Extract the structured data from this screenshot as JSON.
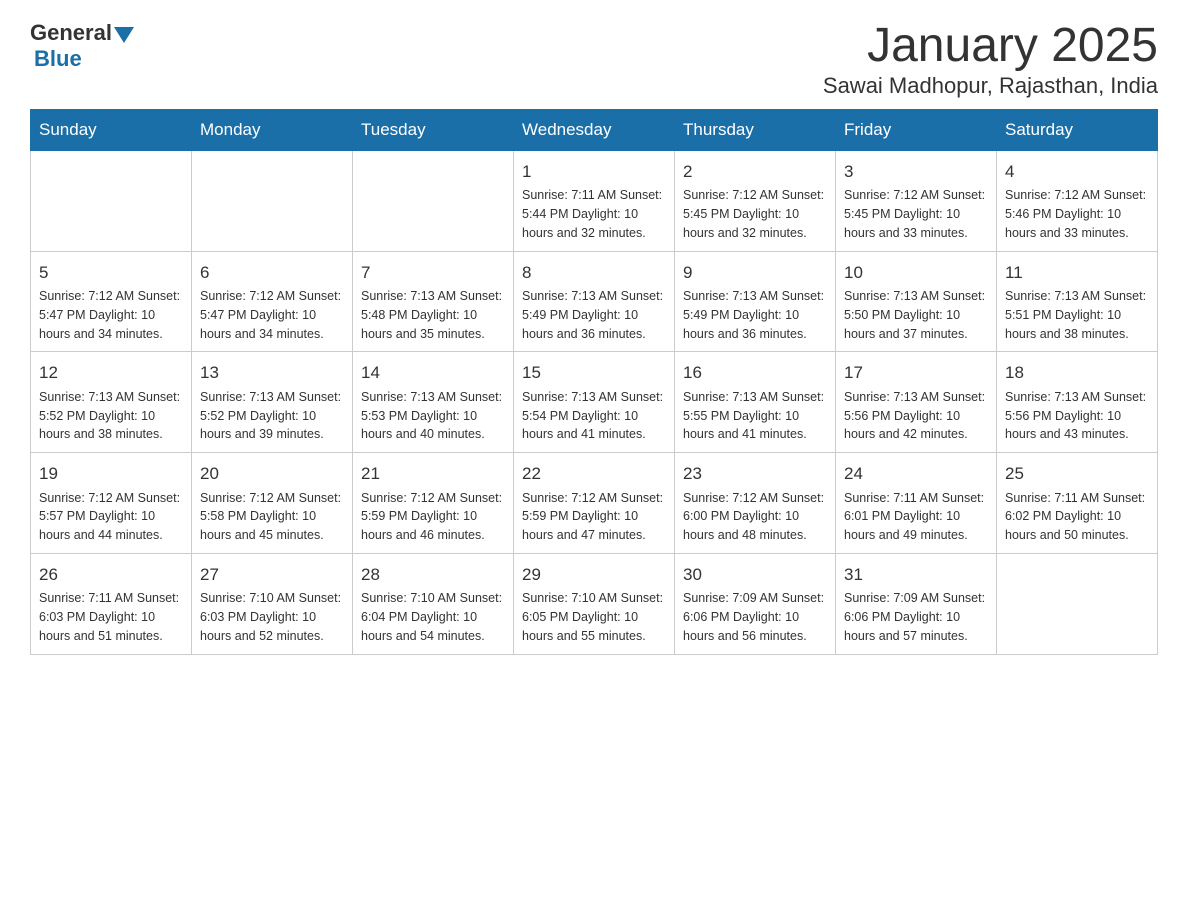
{
  "header": {
    "logo_general": "General",
    "logo_blue": "Blue",
    "title": "January 2025",
    "subtitle": "Sawai Madhopur, Rajasthan, India"
  },
  "days_of_week": [
    "Sunday",
    "Monday",
    "Tuesday",
    "Wednesday",
    "Thursday",
    "Friday",
    "Saturday"
  ],
  "weeks": [
    [
      {
        "day": "",
        "info": ""
      },
      {
        "day": "",
        "info": ""
      },
      {
        "day": "",
        "info": ""
      },
      {
        "day": "1",
        "info": "Sunrise: 7:11 AM\nSunset: 5:44 PM\nDaylight: 10 hours\nand 32 minutes."
      },
      {
        "day": "2",
        "info": "Sunrise: 7:12 AM\nSunset: 5:45 PM\nDaylight: 10 hours\nand 32 minutes."
      },
      {
        "day": "3",
        "info": "Sunrise: 7:12 AM\nSunset: 5:45 PM\nDaylight: 10 hours\nand 33 minutes."
      },
      {
        "day": "4",
        "info": "Sunrise: 7:12 AM\nSunset: 5:46 PM\nDaylight: 10 hours\nand 33 minutes."
      }
    ],
    [
      {
        "day": "5",
        "info": "Sunrise: 7:12 AM\nSunset: 5:47 PM\nDaylight: 10 hours\nand 34 minutes."
      },
      {
        "day": "6",
        "info": "Sunrise: 7:12 AM\nSunset: 5:47 PM\nDaylight: 10 hours\nand 34 minutes."
      },
      {
        "day": "7",
        "info": "Sunrise: 7:13 AM\nSunset: 5:48 PM\nDaylight: 10 hours\nand 35 minutes."
      },
      {
        "day": "8",
        "info": "Sunrise: 7:13 AM\nSunset: 5:49 PM\nDaylight: 10 hours\nand 36 minutes."
      },
      {
        "day": "9",
        "info": "Sunrise: 7:13 AM\nSunset: 5:49 PM\nDaylight: 10 hours\nand 36 minutes."
      },
      {
        "day": "10",
        "info": "Sunrise: 7:13 AM\nSunset: 5:50 PM\nDaylight: 10 hours\nand 37 minutes."
      },
      {
        "day": "11",
        "info": "Sunrise: 7:13 AM\nSunset: 5:51 PM\nDaylight: 10 hours\nand 38 minutes."
      }
    ],
    [
      {
        "day": "12",
        "info": "Sunrise: 7:13 AM\nSunset: 5:52 PM\nDaylight: 10 hours\nand 38 minutes."
      },
      {
        "day": "13",
        "info": "Sunrise: 7:13 AM\nSunset: 5:52 PM\nDaylight: 10 hours\nand 39 minutes."
      },
      {
        "day": "14",
        "info": "Sunrise: 7:13 AM\nSunset: 5:53 PM\nDaylight: 10 hours\nand 40 minutes."
      },
      {
        "day": "15",
        "info": "Sunrise: 7:13 AM\nSunset: 5:54 PM\nDaylight: 10 hours\nand 41 minutes."
      },
      {
        "day": "16",
        "info": "Sunrise: 7:13 AM\nSunset: 5:55 PM\nDaylight: 10 hours\nand 41 minutes."
      },
      {
        "day": "17",
        "info": "Sunrise: 7:13 AM\nSunset: 5:56 PM\nDaylight: 10 hours\nand 42 minutes."
      },
      {
        "day": "18",
        "info": "Sunrise: 7:13 AM\nSunset: 5:56 PM\nDaylight: 10 hours\nand 43 minutes."
      }
    ],
    [
      {
        "day": "19",
        "info": "Sunrise: 7:12 AM\nSunset: 5:57 PM\nDaylight: 10 hours\nand 44 minutes."
      },
      {
        "day": "20",
        "info": "Sunrise: 7:12 AM\nSunset: 5:58 PM\nDaylight: 10 hours\nand 45 minutes."
      },
      {
        "day": "21",
        "info": "Sunrise: 7:12 AM\nSunset: 5:59 PM\nDaylight: 10 hours\nand 46 minutes."
      },
      {
        "day": "22",
        "info": "Sunrise: 7:12 AM\nSunset: 5:59 PM\nDaylight: 10 hours\nand 47 minutes."
      },
      {
        "day": "23",
        "info": "Sunrise: 7:12 AM\nSunset: 6:00 PM\nDaylight: 10 hours\nand 48 minutes."
      },
      {
        "day": "24",
        "info": "Sunrise: 7:11 AM\nSunset: 6:01 PM\nDaylight: 10 hours\nand 49 minutes."
      },
      {
        "day": "25",
        "info": "Sunrise: 7:11 AM\nSunset: 6:02 PM\nDaylight: 10 hours\nand 50 minutes."
      }
    ],
    [
      {
        "day": "26",
        "info": "Sunrise: 7:11 AM\nSunset: 6:03 PM\nDaylight: 10 hours\nand 51 minutes."
      },
      {
        "day": "27",
        "info": "Sunrise: 7:10 AM\nSunset: 6:03 PM\nDaylight: 10 hours\nand 52 minutes."
      },
      {
        "day": "28",
        "info": "Sunrise: 7:10 AM\nSunset: 6:04 PM\nDaylight: 10 hours\nand 54 minutes."
      },
      {
        "day": "29",
        "info": "Sunrise: 7:10 AM\nSunset: 6:05 PM\nDaylight: 10 hours\nand 55 minutes."
      },
      {
        "day": "30",
        "info": "Sunrise: 7:09 AM\nSunset: 6:06 PM\nDaylight: 10 hours\nand 56 minutes."
      },
      {
        "day": "31",
        "info": "Sunrise: 7:09 AM\nSunset: 6:06 PM\nDaylight: 10 hours\nand 57 minutes."
      },
      {
        "day": "",
        "info": ""
      }
    ]
  ],
  "accent_color": "#1a6fa8"
}
